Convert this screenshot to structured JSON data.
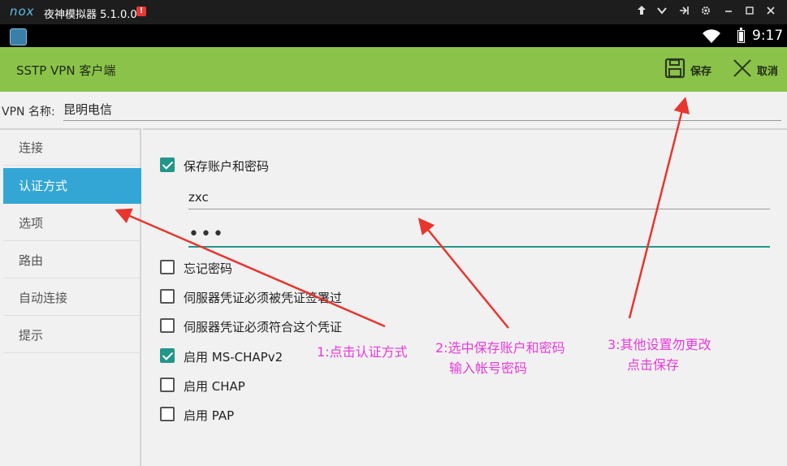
{
  "emulator": {
    "logo": "nox",
    "title": "夜神模拟器 5.1.0.0",
    "alert": "!",
    "controls": [
      "pin-icon",
      "chevron-down-icon",
      "shake-icon",
      "gear-icon",
      "minimize-icon",
      "maximize-icon",
      "close-icon"
    ]
  },
  "statusbar": {
    "time": "9:17"
  },
  "actionbar": {
    "title": "SSTP VPN 客户端",
    "save_label": "保存",
    "cancel_label": "取消"
  },
  "vpn_name": {
    "label": "VPN 名称:",
    "value": "昆明电信"
  },
  "sidebar": {
    "items": [
      {
        "label": "连接",
        "active": false
      },
      {
        "label": "认证方式",
        "active": true
      },
      {
        "label": "选项",
        "active": false
      },
      {
        "label": "路由",
        "active": false
      },
      {
        "label": "自动连接",
        "active": false
      },
      {
        "label": "提示",
        "active": false
      }
    ]
  },
  "panel": {
    "save_account": {
      "label": "保存账户和密码",
      "checked": true
    },
    "username": "zxc",
    "password": "•••",
    "options": [
      {
        "label": "忘记密码",
        "checked": false
      },
      {
        "label": "伺服器凭证必须被凭证签署过",
        "checked": false
      },
      {
        "label": "伺服器凭证必须符合这个凭证",
        "checked": false
      },
      {
        "label": "启用 MS-CHAPv2",
        "checked": true
      },
      {
        "label": "启用 CHAP",
        "checked": false
      },
      {
        "label": "启用 PAP",
        "checked": false
      }
    ]
  },
  "annotations": {
    "step1": "1:点击认证方式",
    "step2_line1": "2:选中保存账户和密码",
    "step2_line2": "输入帐号密码",
    "step3_line1": "3:其他设置勿更改",
    "step3_line2": "点击保存",
    "color": "#e83ad8"
  },
  "colors": {
    "actionbar": "#8bc34a",
    "sidebar_active": "#33a6d6",
    "checkbox": "#23968a"
  }
}
